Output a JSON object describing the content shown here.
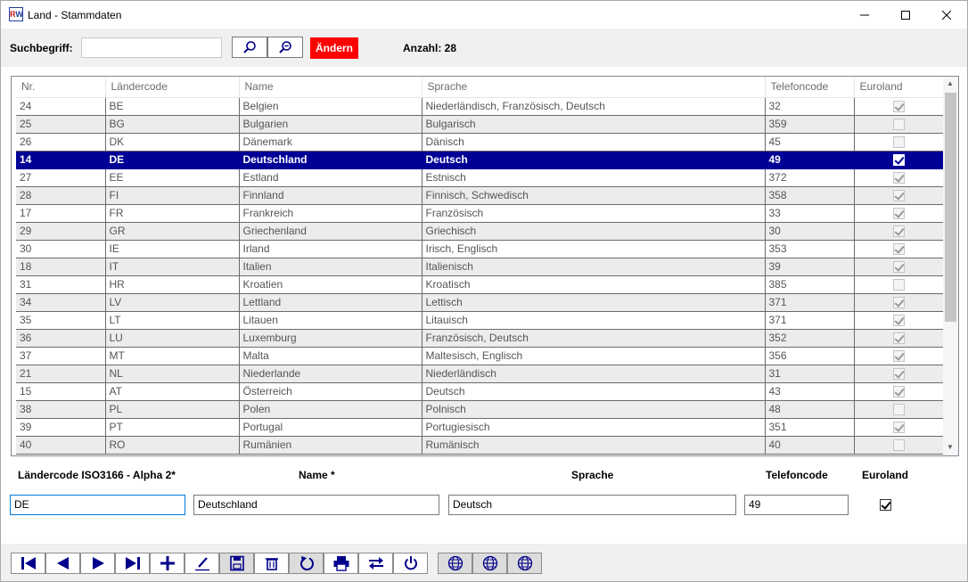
{
  "window": {
    "title": "Land - Stammdaten"
  },
  "search": {
    "label": "Suchbegriff:",
    "value": "",
    "change_button": "Ändern",
    "count_label": "Anzahl: 28"
  },
  "grid": {
    "columns": [
      "Nr.",
      "Ländercode",
      "Name",
      "Sprache",
      "Telefoncode",
      "Euroland"
    ],
    "rows": [
      {
        "nr": "24",
        "code": "BE",
        "name": "Belgien",
        "lang": "Niederländisch, Französisch, Deutsch",
        "tel": "32",
        "euro": true
      },
      {
        "nr": "25",
        "code": "BG",
        "name": "Bulgarien",
        "lang": "Bulgarisch",
        "tel": "359",
        "euro": false
      },
      {
        "nr": "26",
        "code": "DK",
        "name": "Dänemark",
        "lang": "Dänisch",
        "tel": "45",
        "euro": false
      },
      {
        "nr": "14",
        "code": "DE",
        "name": "Deutschland",
        "lang": "Deutsch",
        "tel": "49",
        "euro": true
      },
      {
        "nr": "27",
        "code": "EE",
        "name": "Estland",
        "lang": "Estnisch",
        "tel": "372",
        "euro": true
      },
      {
        "nr": "28",
        "code": "FI",
        "name": "Finnland",
        "lang": "Finnisch, Schwedisch",
        "tel": "358",
        "euro": true
      },
      {
        "nr": "17",
        "code": "FR",
        "name": "Frankreich",
        "lang": "Französisch",
        "tel": "33",
        "euro": true
      },
      {
        "nr": "29",
        "code": "GR",
        "name": "Griechenland",
        "lang": "Griechisch",
        "tel": "30",
        "euro": true
      },
      {
        "nr": "30",
        "code": "IE",
        "name": "Irland",
        "lang": "Irisch, Englisch",
        "tel": "353",
        "euro": true
      },
      {
        "nr": "18",
        "code": "IT",
        "name": "Italien",
        "lang": "Italienisch",
        "tel": "39",
        "euro": true
      },
      {
        "nr": "31",
        "code": "HR",
        "name": "Kroatien",
        "lang": "Kroatisch",
        "tel": "385",
        "euro": false
      },
      {
        "nr": "34",
        "code": "LV",
        "name": "Lettland",
        "lang": "Lettisch",
        "tel": "371",
        "euro": true
      },
      {
        "nr": "35",
        "code": "LT",
        "name": "Litauen",
        "lang": "Litauisch",
        "tel": "371",
        "euro": true
      },
      {
        "nr": "36",
        "code": "LU",
        "name": "Luxemburg",
        "lang": "Französisch, Deutsch",
        "tel": "352",
        "euro": true
      },
      {
        "nr": "37",
        "code": "MT",
        "name": "Malta",
        "lang": "Maltesisch, Englisch",
        "tel": "356",
        "euro": true
      },
      {
        "nr": "21",
        "code": "NL",
        "name": "Niederlande",
        "lang": "Niederländisch",
        "tel": "31",
        "euro": true
      },
      {
        "nr": "15",
        "code": "AT",
        "name": "Österreich",
        "lang": "Deutsch",
        "tel": "43",
        "euro": true
      },
      {
        "nr": "38",
        "code": "PL",
        "name": "Polen",
        "lang": "Polnisch",
        "tel": "48",
        "euro": false
      },
      {
        "nr": "39",
        "code": "PT",
        "name": "Portugal",
        "lang": "Portugiesisch",
        "tel": "351",
        "euro": true
      },
      {
        "nr": "40",
        "code": "RO",
        "name": "Rumänien",
        "lang": "Rumänisch",
        "tel": "40",
        "euro": false
      }
    ],
    "selected_index": 3
  },
  "edit": {
    "code_label": "Ländercode ISO3166 - Alpha 2*",
    "name_label": "Name *",
    "lang_label": "Sprache",
    "tel_label": "Telefoncode",
    "euro_label": "Euroland",
    "code_value": "DE",
    "name_value": "Deutschland",
    "lang_value": "Deutsch",
    "tel_value": "49",
    "euro_value": true
  },
  "colors": {
    "selection": "#000096",
    "accent_red": "#ff0000",
    "icon_blue": "#00008b"
  },
  "toolbar": {
    "icons": [
      "first-record-icon",
      "previous-record-icon",
      "next-record-icon",
      "last-record-icon",
      "add-icon",
      "edit-icon",
      "save-icon",
      "delete-icon",
      "undo-icon",
      "print-icon",
      "swap-icon",
      "power-icon",
      "globe-icon",
      "globe-icon",
      "globe-icon"
    ]
  }
}
